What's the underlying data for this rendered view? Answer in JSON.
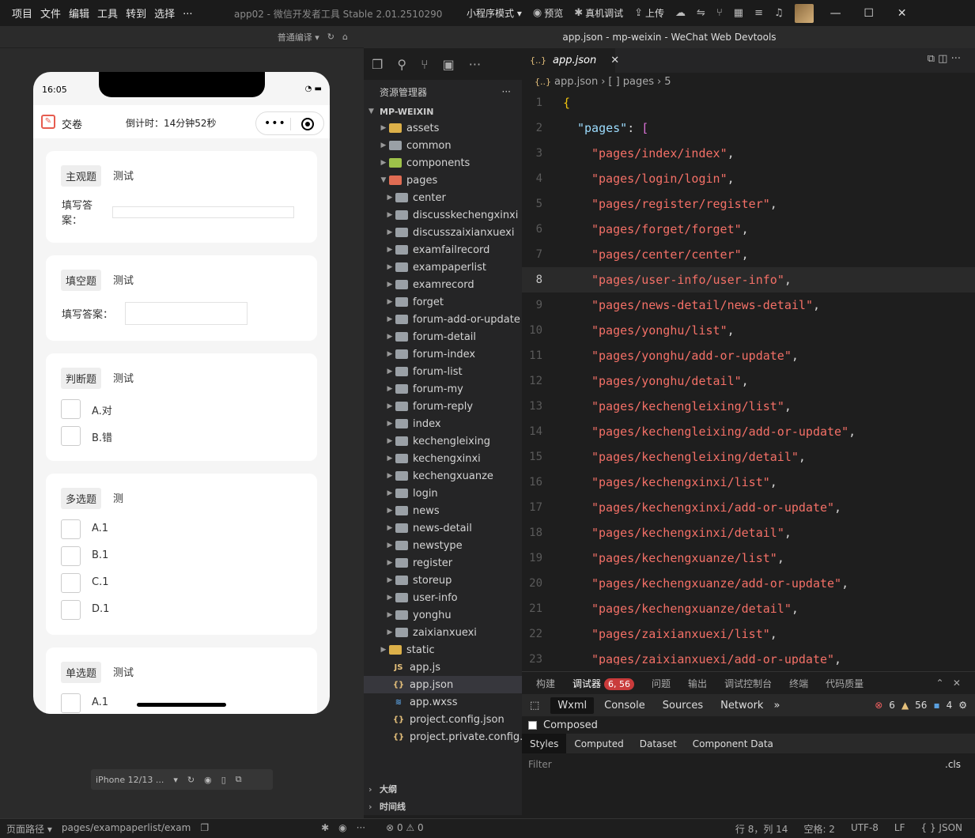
{
  "menu": [
    "项目",
    "文件",
    "编辑",
    "工具",
    "转到",
    "选择",
    "..."
  ],
  "app_title": "app02 - 微信开发者工具 Stable 2.01.2510290",
  "top_actions": {
    "mode": "小程序模式 ▾",
    "preview": "预览",
    "debug": "真机调试",
    "upload": "上传"
  },
  "window_title": "app.json - mp-weixin - WeChat Web Devtools",
  "simulator": {
    "compile_mode": "普通编译 ▾",
    "time": "16:05",
    "submit": "交卷",
    "countdown": "倒计时：14分钟52秒",
    "device": "iPhone 12/13 ...",
    "questions": [
      {
        "tag": "主观题",
        "title": "测试",
        "label": "填写答案："
      },
      {
        "tag": "填空题",
        "title": "测试",
        "label": "填写答案："
      },
      {
        "tag": "判断题",
        "title": "测试",
        "options": [
          "A.对",
          "B.错"
        ]
      },
      {
        "tag": "多选题",
        "title": "测",
        "options": [
          "A.1",
          "B.1",
          "C.1",
          "D.1"
        ]
      },
      {
        "tag": "单选题",
        "title": "测试",
        "options": [
          "A.1"
        ]
      }
    ]
  },
  "explorer": {
    "header": "资源管理器",
    "root": "MP-WEIXIN",
    "top_folders": [
      "assets",
      "common",
      "components",
      "pages"
    ],
    "page_folders": [
      "center",
      "discusskechengxinxi",
      "discusszaixianxuexi",
      "examfailrecord",
      "exampaperlist",
      "examrecord",
      "forget",
      "forum-add-or-update",
      "forum-detail",
      "forum-index",
      "forum-list",
      "forum-my",
      "forum-reply",
      "index",
      "kechengleixing",
      "kechengxinxi",
      "kechengxuanze",
      "login",
      "news",
      "news-detail",
      "newstype",
      "register",
      "storeup",
      "user-info",
      "yonghu",
      "zaixianxuexi"
    ],
    "static": "static",
    "files": [
      "app.js",
      "app.json",
      "app.wxss",
      "project.config.json",
      "project.private.config.js..."
    ],
    "sections": [
      "大纲",
      "时间线"
    ]
  },
  "editor": {
    "tab": "app.json",
    "breadcrumb": [
      "app.json",
      "[ ] pages",
      "5"
    ],
    "open_brace": "{",
    "key": "\"pages\"",
    "colon": ": ",
    "bracket": "[",
    "pages": [
      "pages/index/index",
      "pages/login/login",
      "pages/register/register",
      "pages/forget/forget",
      "pages/center/center",
      "pages/user-info/user-info",
      "pages/news-detail/news-detail",
      "pages/yonghu/list",
      "pages/yonghu/add-or-update",
      "pages/yonghu/detail",
      "pages/kechengleixing/list",
      "pages/kechengleixing/add-or-update",
      "pages/kechengleixing/detail",
      "pages/kechengxinxi/list",
      "pages/kechengxinxi/add-or-update",
      "pages/kechengxinxi/detail",
      "pages/kechengxuanze/list",
      "pages/kechengxuanze/add-or-update",
      "pages/kechengxuanze/detail",
      "pages/zaixianxuexi/list",
      "pages/zaixianxuexi/add-or-update"
    ],
    "current_line": 8
  },
  "panel": {
    "tabs": [
      "构建",
      "调试器",
      "问题",
      "输出",
      "调试控制台",
      "终端",
      "代码质量"
    ],
    "debugger_badge": "6, 56",
    "dev_tabs": [
      "Wxml",
      "Console",
      "Sources",
      "Network"
    ],
    "errors": "6",
    "warnings": "56",
    "infos": "4",
    "composed": "Composed",
    "style_tabs": [
      "Styles",
      "Computed",
      "Dataset",
      "Component Data"
    ],
    "filter": "Filter",
    "cls": ".cls"
  },
  "statusbar": {
    "page_path_label": "页面路径 ▾",
    "page_path": "pages/exampaperlist/exam",
    "errors": "⊗ 0 ⚠ 0",
    "position": "行 8，列 14",
    "spaces": "空格: 2",
    "encoding": "UTF-8",
    "eol": "LF",
    "language": "{ } JSON"
  },
  "colors": {
    "string": "#f47067",
    "key": "#9cdcfe",
    "brace": "#f1c40f",
    "bracket": "#da70d6"
  }
}
